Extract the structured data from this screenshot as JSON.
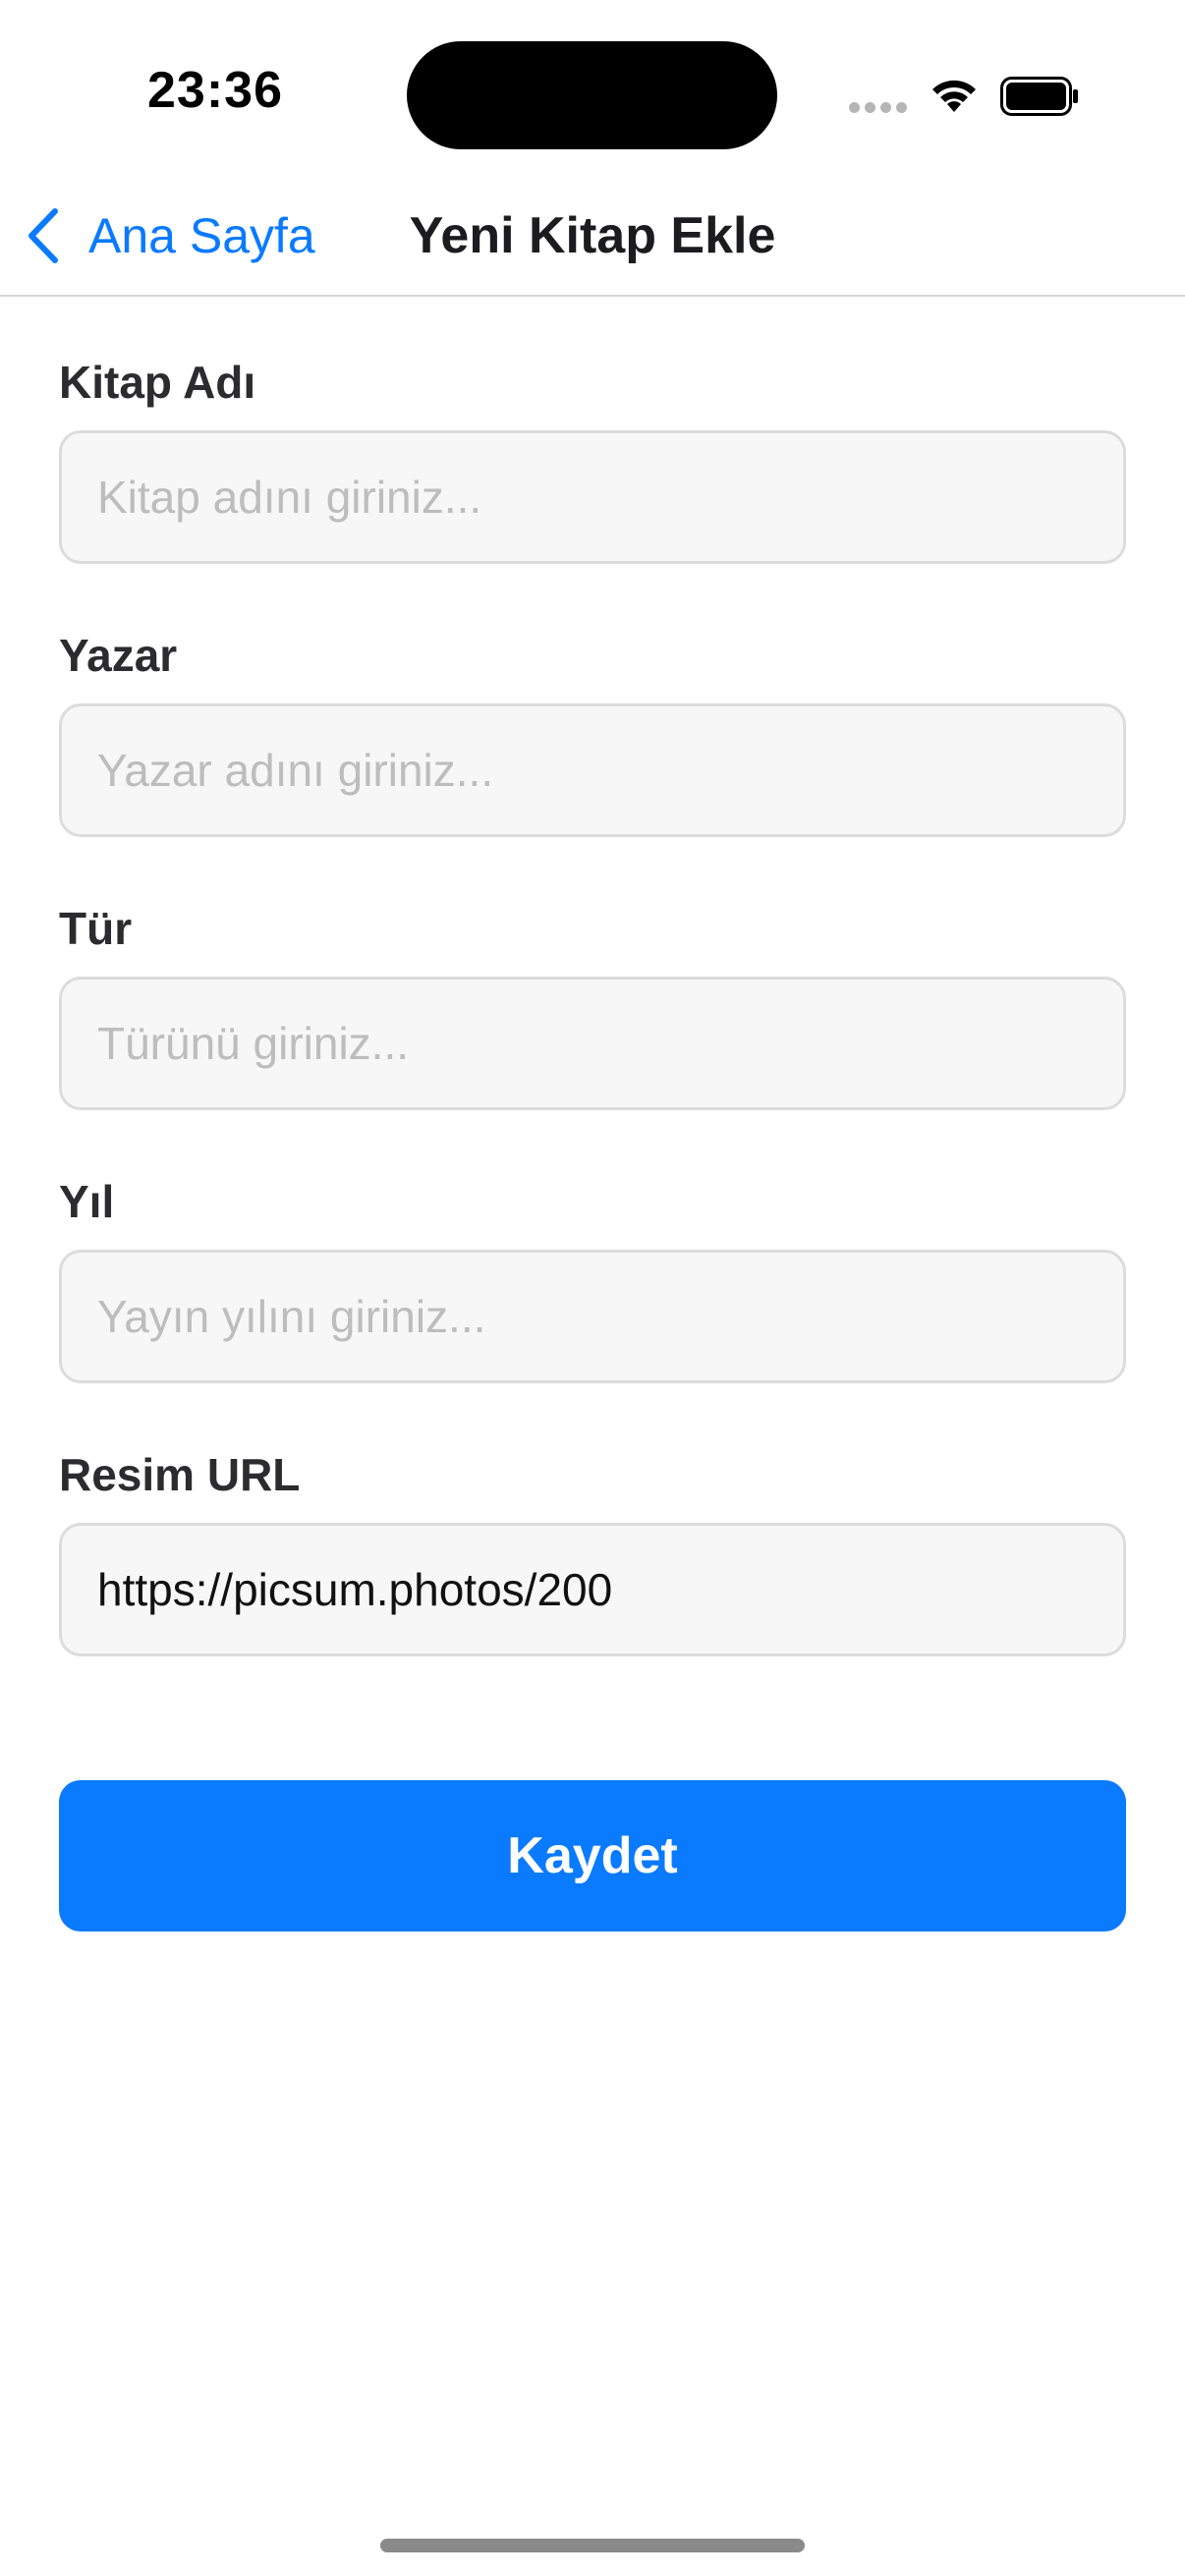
{
  "status_bar": {
    "time": "23:36",
    "icons": [
      "signal-icon",
      "wifi-icon",
      "battery-icon"
    ]
  },
  "nav": {
    "back_label": "Ana Sayfa",
    "back_icon": "chevron-left-icon",
    "title": "Yeni Kitap Ekle"
  },
  "form": {
    "fields": [
      {
        "label": "Kitap Adı",
        "placeholder": "Kitap adını giriniz...",
        "value": ""
      },
      {
        "label": "Yazar",
        "placeholder": "Yazar adını giriniz...",
        "value": ""
      },
      {
        "label": "Tür",
        "placeholder": "Türünü giriniz...",
        "value": ""
      },
      {
        "label": "Yıl",
        "placeholder": "Yayın yılını giriniz...",
        "value": ""
      },
      {
        "label": "Resim URL",
        "placeholder": "",
        "value": "https://picsum.photos/200"
      }
    ],
    "save_label": "Kaydet"
  },
  "colors": {
    "accent": "#0a7aff",
    "input_background": "#f7f7f7",
    "input_border": "#dcdcdc"
  }
}
